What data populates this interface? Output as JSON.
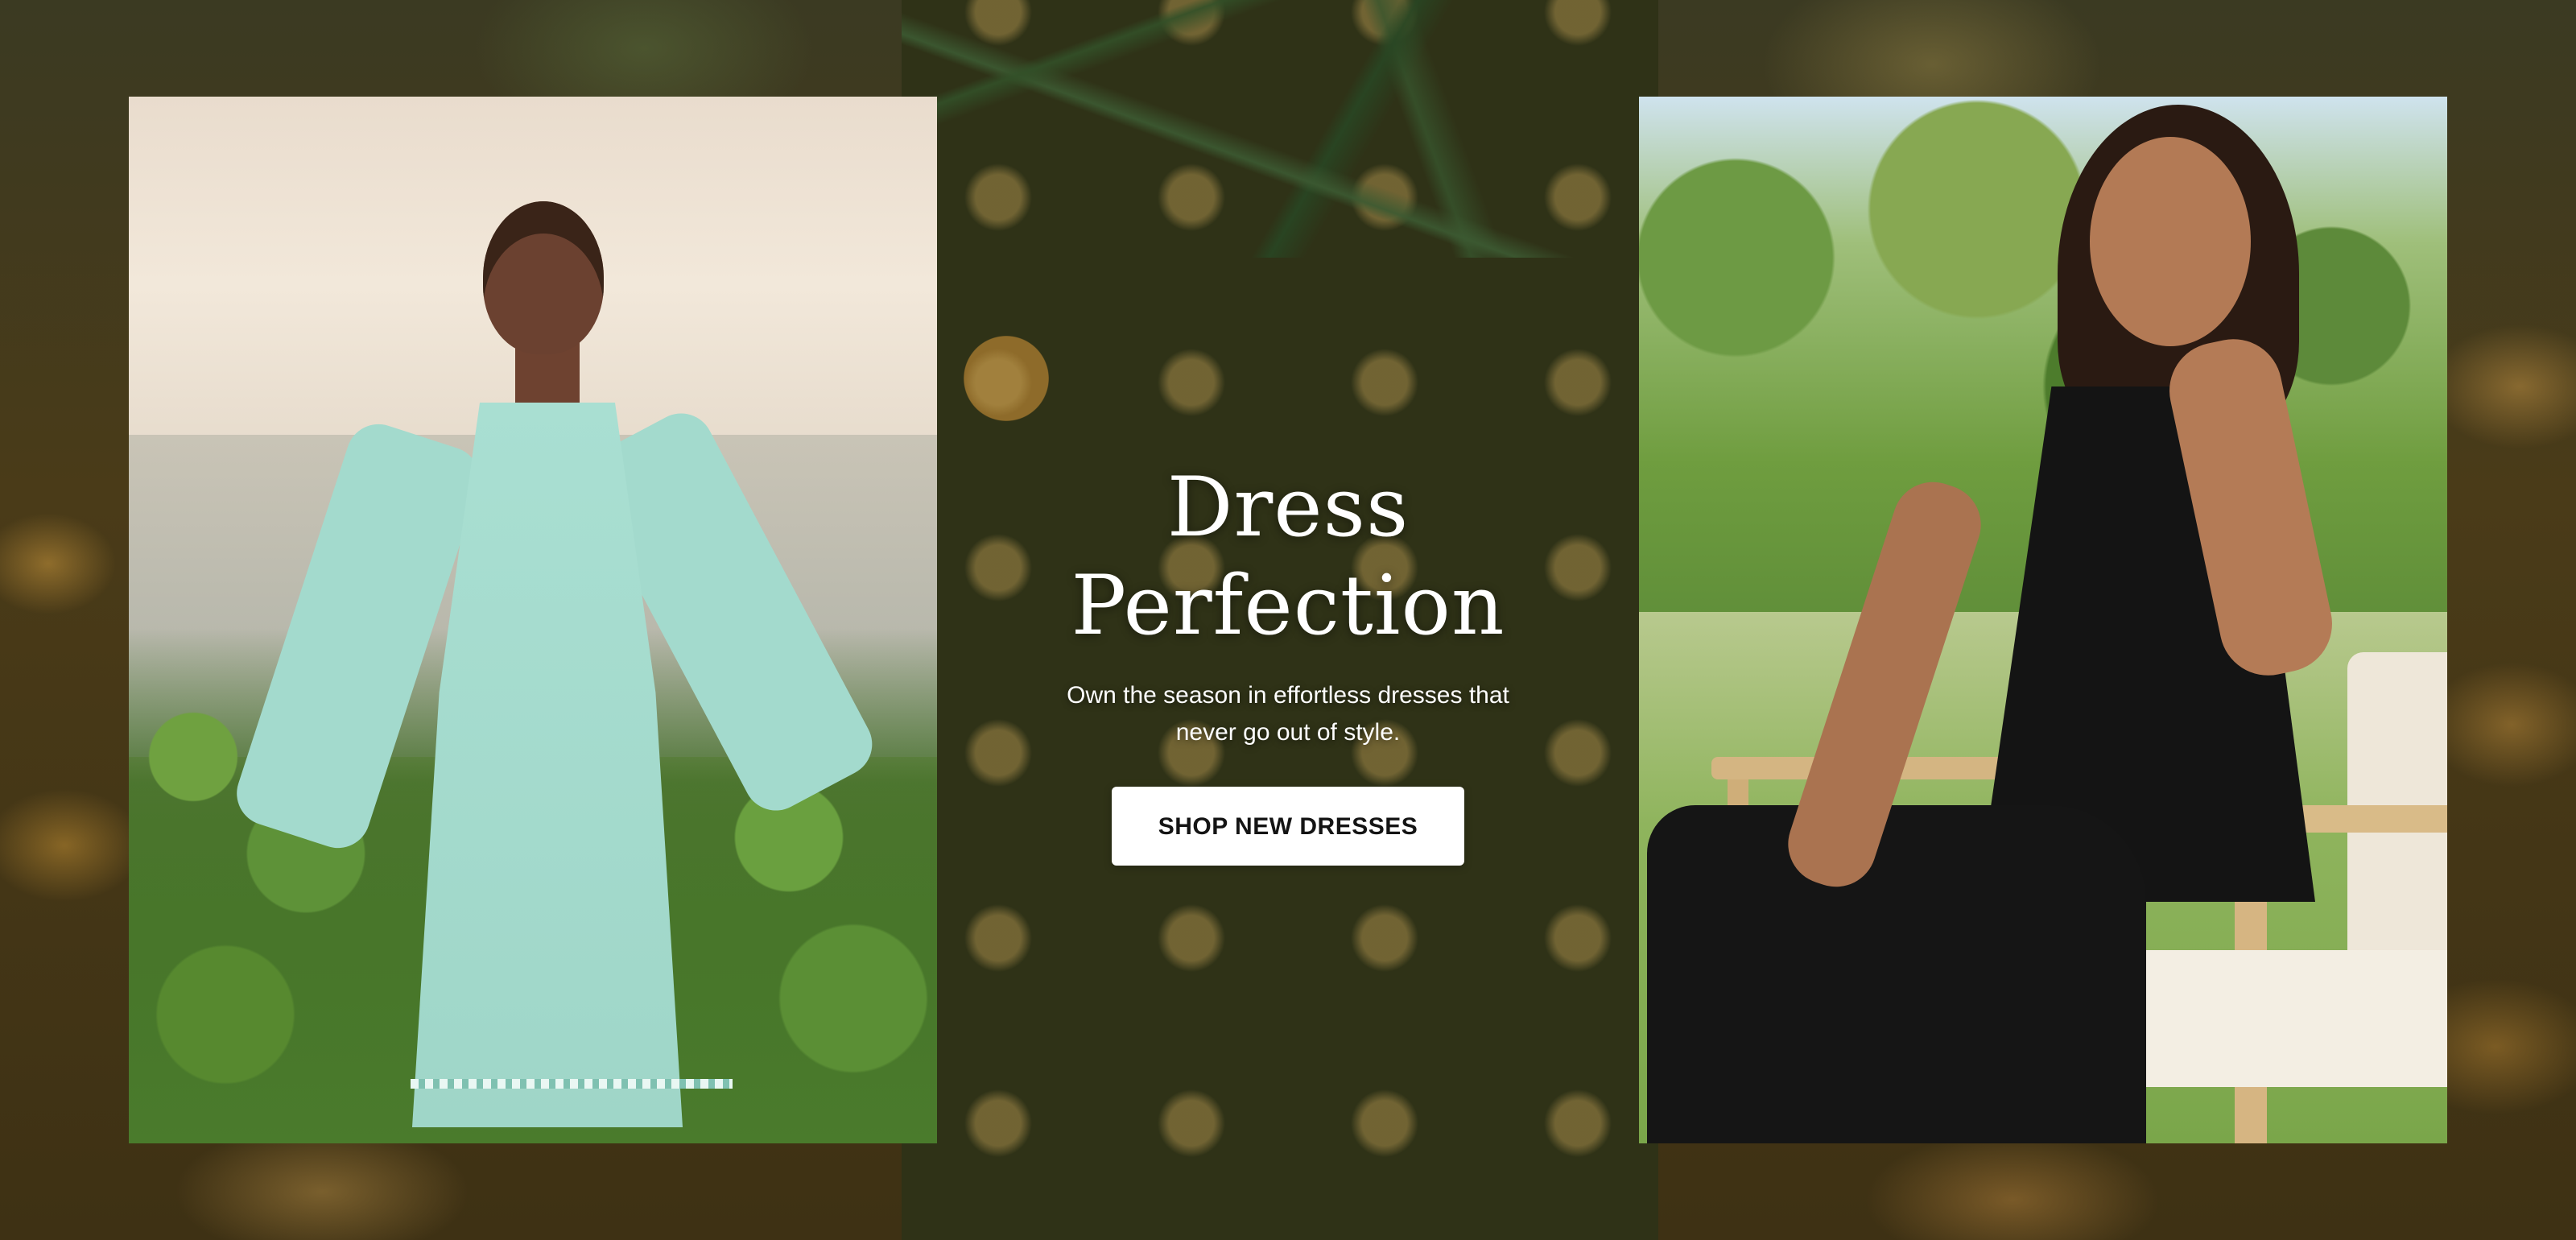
{
  "hero": {
    "headline": "Dress Perfection",
    "subtext": "Own the season in effortless dresses that never go out of style.",
    "cta_label": "SHOP NEW DRESSES"
  },
  "images": {
    "left_photo": "model-in-mint-dress",
    "right_photo": "model-in-black-dress",
    "background": "pineapple-background"
  },
  "colors": {
    "cta_background": "#ffffff",
    "cta_text": "#141414",
    "headline_text": "#ffffff"
  }
}
